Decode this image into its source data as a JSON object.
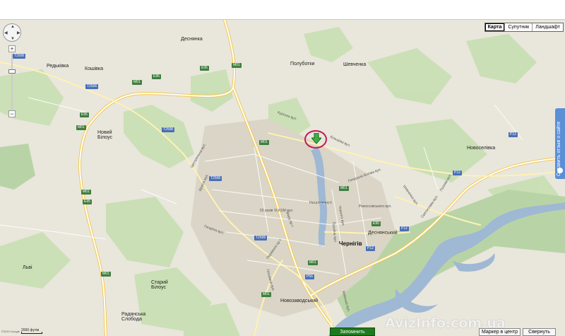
{
  "map_type": {
    "map": "Карта",
    "satellite": "Супутник",
    "terrain": "Ландшафт"
  },
  "feedback": "Оставить отзыв о сайте",
  "marker": {
    "icon": "download-arrow-icon"
  },
  "places": {
    "desnianka": "Деснянка",
    "redkivka": "Редьківка",
    "koshivka": "Кошівка",
    "polubotky": "Полуботки",
    "shevchenka": "Шевченка",
    "novyi_bilous": "Новий\nБілоус",
    "novoselivka": "Новоселівка",
    "chernihiv": "Чернігів",
    "desnianskyi": "Деснянський",
    "lyiv": "Льві",
    "staryi_bilous": "Старий\nБілоус",
    "novozavodskyi": "Новозаводський",
    "radianska_sloboda": "Радянська\nСлобода"
  },
  "streets": {
    "kurska": "Курська вул.",
    "kiltseva": "Кільцева вул.",
    "tsentralna": "Центральна вул.",
    "gagarina": "Гагаріна вул.",
    "shchorsa": "Щорса вул.",
    "50_vlksm": "50 років VLKSM вул.",
    "nezalezhnosti": "Незалежності",
    "myru": "Миру пр-т",
    "peremohy": "Перемоги пр-т",
    "rokossovskogo": "Рокоссовського вул.",
    "chervonogo": "Чорного вул.",
    "pushkina": "Пушкіна вул.",
    "shevchenka_vul": "Шевченка вул.",
    "sviatoslava": "Святослава вул.",
    "popovych": "Попова вул.",
    "belova": "Генерала Білова вул.",
    "kyivska": "Київська вул.",
    "hlibova": "Гетьмана вул."
  },
  "routes": {
    "t2506a": "T2506",
    "m01a": "M01",
    "e95a": "E95",
    "t2506b": "T2506",
    "m01b": "M01",
    "e95b": "E95",
    "m01c": "M01",
    "t2506c": "T2506",
    "m01d": "M01",
    "t2506d": "T2506",
    "m01e": "M01",
    "e95c": "E95",
    "m01f": "M01",
    "p12a": "P12",
    "p12b": "P12",
    "p12c": "P12",
    "m01g": "M01",
    "p56": "P56",
    "e95d": "E95",
    "m01h": "M01",
    "t2506e": "T2506",
    "p12d": "P12",
    "m01i": "M01"
  },
  "copyright": "©2010 Google",
  "scale": "2000 футів",
  "buttons": {
    "remember": "Запомнить позицию",
    "center": "Маркер в центр",
    "collapse": "Свернуть"
  },
  "watermark": "AvizInfo.com.ua"
}
